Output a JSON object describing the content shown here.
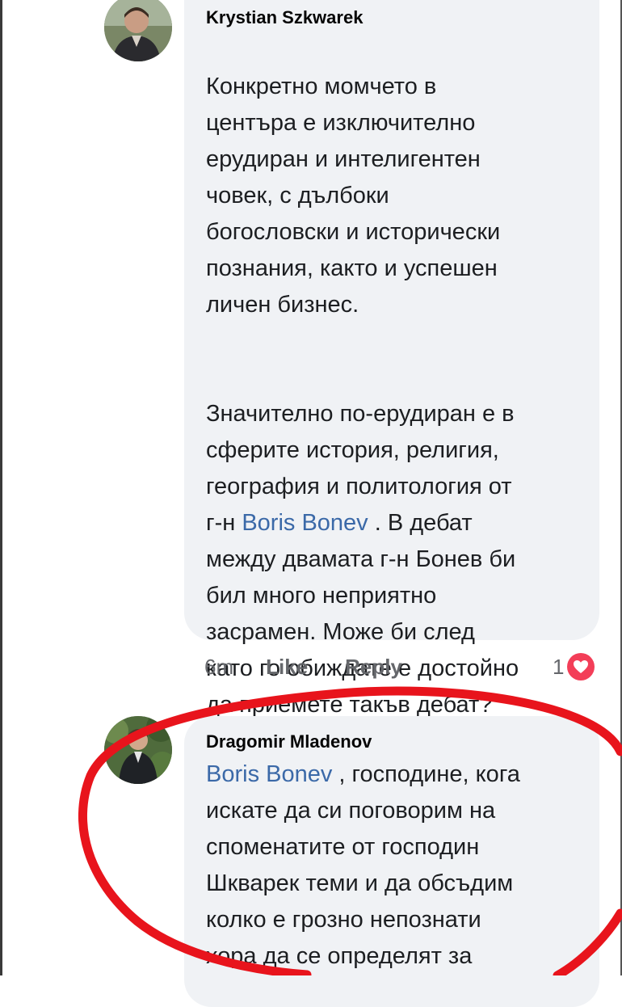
{
  "comments": [
    {
      "author": "Krystian Szkwarek",
      "paragraph_1": "Конкретно момчето в\nцентъра е изключително\nерудиран и интелигентен\nчовек, с дълбоки\nбогословски и исторически\nпознания, както и успешен\nличен бизнес.",
      "paragraph_2_before": "Значително по-ерудиран е в\nсферите история, религия,\nгеография и политология от\nг-н ",
      "paragraph_2_mention": "Boris Bonev",
      "paragraph_2_after": " .  В дебат\nмежду двамата г-н Бонев би\nбил много неприятно\nзасрамен. Може би след\nкато го обиждате е достойно\nда приемете такъв дебат?",
      "time": "6m",
      "like_label": "Like",
      "reply_label": "Reply",
      "reaction_count": "1",
      "reaction_icon": "heart-icon"
    },
    {
      "author": "Dragomir Mladenov",
      "mention": "Boris Bonev",
      "text_after_mention": " , господине, кога\nискате да си поговорим на\nспоменатите от господин\nШкварек теми и да обсъдим\nколко е грозно непознати\nхора да се определят за"
    }
  ],
  "colors": {
    "bubble": "#f0f2f5",
    "mention": "#3b69a8",
    "meta": "#65676b",
    "heart": "#f33e58",
    "annotation_circle": "#e8141c"
  }
}
